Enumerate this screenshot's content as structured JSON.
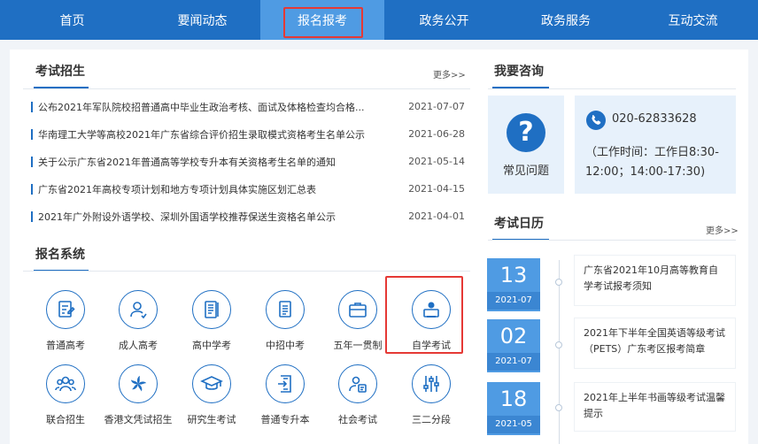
{
  "nav": {
    "items": [
      {
        "label": "首页"
      },
      {
        "label": "要闻动态"
      },
      {
        "label": "报名报考"
      },
      {
        "label": "政务公开"
      },
      {
        "label": "政务服务"
      },
      {
        "label": "互动交流"
      }
    ],
    "active_index": 2
  },
  "exam_admission": {
    "title": "考试招生",
    "more": "更多>>",
    "news": [
      {
        "title": "公布2021年军队院校招普通高中毕业生政治考核、面试及体格检查均合格...",
        "date": "2021-07-07"
      },
      {
        "title": "华南理工大学等高校2021年广东省综合评价招生录取模式资格考生名单公示",
        "date": "2021-06-28"
      },
      {
        "title": "关于公示广东省2021年普通高等学校专升本有关资格考生名单的通知",
        "date": "2021-05-14"
      },
      {
        "title": "广东省2021年高校专项计划和地方专项计划具体实施区划汇总表",
        "date": "2021-04-15"
      },
      {
        "title": "2021年广外附设外语学校、深圳外国语学校推荐保送生资格名单公示",
        "date": "2021-04-01"
      }
    ]
  },
  "registration": {
    "title": "报名系统",
    "items": [
      {
        "label": "普通高考",
        "icon": "exam-paper-icon"
      },
      {
        "label": "成人高考",
        "icon": "person-icon"
      },
      {
        "label": "高中学考",
        "icon": "notebook-icon"
      },
      {
        "label": "中招中考",
        "icon": "document-icon"
      },
      {
        "label": "五年一贯制",
        "icon": "briefcase-icon"
      },
      {
        "label": "自学考试",
        "icon": "computer-user-icon"
      },
      {
        "label": "联合招生",
        "icon": "group-icon"
      },
      {
        "label": "香港文凭试招生",
        "icon": "bauhinia-icon"
      },
      {
        "label": "研究生考试",
        "icon": "graduation-cap-icon"
      },
      {
        "label": "普通专升本",
        "icon": "upgrade-doc-icon"
      },
      {
        "label": "社会考试",
        "icon": "person-doc-icon"
      },
      {
        "label": "三二分段",
        "icon": "sliders-icon"
      }
    ]
  },
  "consult": {
    "title": "我要咨询",
    "faq_label": "常见问题",
    "phone": "020-62833628",
    "hours": "（工作时间：工作日8:30-12:00；14:00-17:30)"
  },
  "calendar": {
    "title": "考试日历",
    "more": "更多>>",
    "events": [
      {
        "day": "13",
        "ym": "2021-07",
        "text": "广东省2021年10月高等教育自学考试报考须知"
      },
      {
        "day": "02",
        "ym": "2021-07",
        "text": "2021年下半年全国英语等级考试（PETS）广东考区报考简章"
      },
      {
        "day": "18",
        "ym": "2021-05",
        "text": "2021年上半年书画等级考试温馨提示"
      }
    ]
  },
  "colors": {
    "primary": "#1f6fc3",
    "active": "#4f9be3",
    "highlight": "#e53935"
  }
}
